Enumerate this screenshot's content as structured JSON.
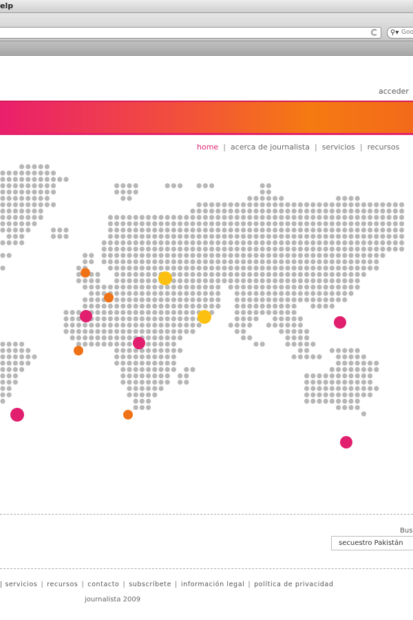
{
  "browser": {
    "menu_fragment": "elp",
    "search_placeholder": "Goo",
    "search_icon": "magnifier-icon"
  },
  "header": {
    "login_label": "acceder"
  },
  "nav": {
    "items": [
      {
        "label": "home",
        "active": true
      },
      {
        "label": "acerca de journalista",
        "active": false
      },
      {
        "label": "servicios",
        "active": false
      },
      {
        "label": "recursos",
        "active": false
      }
    ]
  },
  "map": {
    "dot_color": "#b7b7b7",
    "markers": [
      {
        "color": "#f07217",
        "size": "small"
      },
      {
        "color": "#fcc010",
        "size": "large"
      },
      {
        "color": "#f07217",
        "size": "small"
      },
      {
        "color": "#e11f6e",
        "size": "medium"
      },
      {
        "color": "#fcc010",
        "size": "large"
      },
      {
        "color": "#e11f6e",
        "size": "medium"
      },
      {
        "color": "#e11f6e",
        "size": "medium"
      },
      {
        "color": "#f07217",
        "size": "small"
      },
      {
        "color": "#e11f6e",
        "size": "large"
      },
      {
        "color": "#f07217",
        "size": "small"
      },
      {
        "color": "#e11f6e",
        "size": "medium"
      }
    ]
  },
  "search": {
    "label": "Bus",
    "value": "secuestro Pakistán"
  },
  "footer": {
    "links": [
      "|",
      "servicios",
      "recursos",
      "contacto",
      "subscríbete",
      "información legal",
      "política de privacidad"
    ],
    "copyright": "journalista 2009"
  },
  "colors": {
    "accent_pink": "#e11f6e",
    "accent_orange": "#f07217",
    "accent_yellow": "#fcc010"
  }
}
